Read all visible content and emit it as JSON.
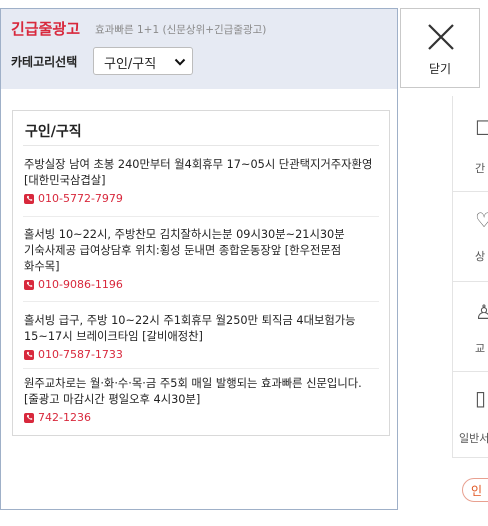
{
  "header": {
    "title": "긴급줄광고",
    "subtitle": "효과빠른 1+1 (신문상위+긴급줄광고)",
    "category_label": "카테고리선택",
    "category_selected": "구인/구직",
    "close_label": "닫기"
  },
  "section": {
    "title": "구인/구직",
    "ads": [
      {
        "text": "주방실장 남여 초봉 240만부터 월4회휴무 17~05시 단관택지거주자환영 [대한민국삼겹살]",
        "phone": "010-5772-7979"
      },
      {
        "text": "홀서빙 10~22시, 주방찬모 김치잘하시는분 09시30분~21시30분 기숙사제공 급여상담후 위치:횡성 둔내면 종합운동장앞 [한우전문점 화수목]",
        "phone": "010-9086-1196"
      },
      {
        "text": "홀서빙 급구, 주방 10~22시 주1회휴무 월250만 퇴직금 4대보험가능 15~17시 브레이크타임 [갈비애정찬]",
        "phone": "010-7587-1733"
      },
      {
        "text": "원주교차로는 월·화·수·목·금 주5회 매일 발행되는 효과빠른 신문입니다. [줄광고 마감시간 평일오후 4시30분]",
        "phone": "742-1236"
      }
    ]
  },
  "background": {
    "side_labels": [
      "간",
      "상",
      "교",
      "일반서"
    ],
    "pill_label": "인"
  },
  "icons": {
    "close": "close-x-icon",
    "phone": "phone-icon",
    "dropdown": "chevron-down-icon"
  },
  "colors": {
    "accent": "#d8283c",
    "header_bg": "#e6eaf3"
  }
}
